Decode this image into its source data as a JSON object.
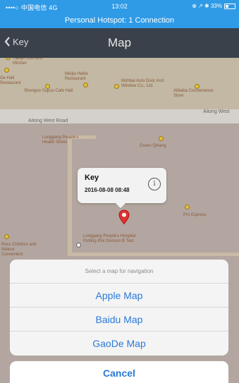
{
  "status_bar": {
    "carrier": "••••○ 中国电信  4G",
    "time": "13:02",
    "right": "⊕ ↗ ✱ 33%",
    "hotspot": "Personal Hotspot: 1 Connection"
  },
  "nav": {
    "back_label": "Key",
    "title": "Map"
  },
  "map": {
    "road_main": "Aitong West Road",
    "road_right": "Aitong West",
    "pois": [
      "Tianjin Guo and Minster",
      "Ge Hall Restaurant",
      "Meijia Haibo Restaurant",
      "Shengoo Supos Cafe Hall",
      "Mohbai Auto Door And Window Co., Ltd.",
      "Alibaba Convenience Store",
      "Longgang People's Health Street",
      "Green Qihang",
      "Pro Express",
      "Ross Children and Mature Convenient",
      "Longgang People's Hospital Putting Plot Division B Test"
    ]
  },
  "callout": {
    "title": "Key",
    "subtitle": "2016-08-08 08:48",
    "info_glyph": "i"
  },
  "action_sheet": {
    "title": "Select a map for navigation",
    "options": [
      "Apple Map",
      "Baidu Map",
      "GaoDe Map"
    ],
    "cancel": "Cancel"
  },
  "colors": {
    "status_bar": "#2f9ae6",
    "nav_bar": "#3b414a",
    "action_text": "#2a7ad8",
    "pin": "#e03030"
  },
  "icons": {
    "back": "chevron-left-icon",
    "info": "info-circle-icon",
    "pin": "map-pin-icon",
    "poi": "poi-marker-icon"
  }
}
